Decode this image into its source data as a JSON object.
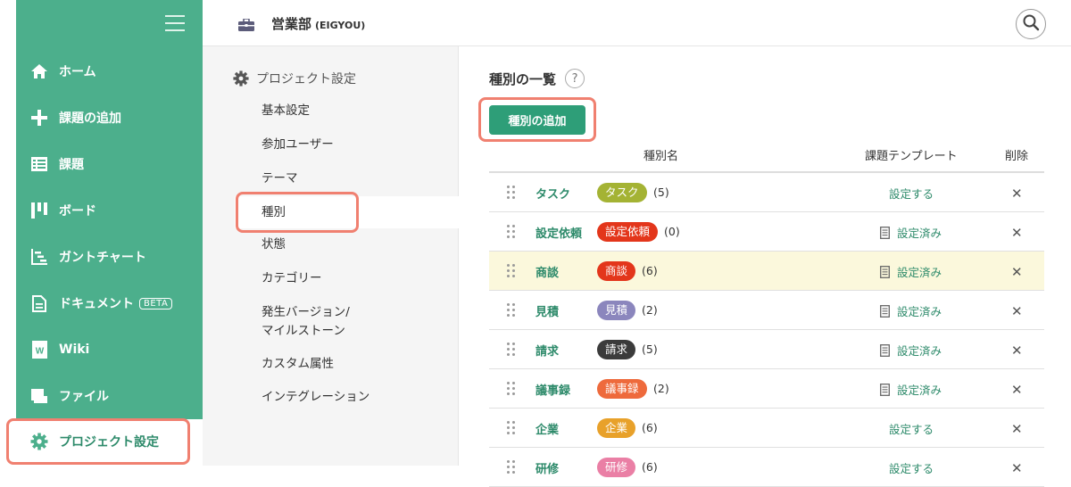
{
  "header": {
    "project_name": "営業部",
    "project_code": "(EIGYOU)"
  },
  "sidebar": {
    "items": [
      {
        "label": "ホーム",
        "icon": "home-icon"
      },
      {
        "label": "課題の追加",
        "icon": "plus-icon"
      },
      {
        "label": "課題",
        "icon": "list-icon"
      },
      {
        "label": "ボード",
        "icon": "board-icon"
      },
      {
        "label": "ガントチャート",
        "icon": "gantt-icon"
      },
      {
        "label": "ドキュメント",
        "icon": "document-icon",
        "badge": "BETA"
      },
      {
        "label": "Wiki",
        "icon": "wiki-icon"
      },
      {
        "label": "ファイル",
        "icon": "folder-icon"
      }
    ],
    "active_item": {
      "label": "プロジェクト設定",
      "icon": "gear-icon"
    }
  },
  "subnav": {
    "heading": "プロジェクト設定",
    "items": [
      "基本設定",
      "参加ユーザー",
      "テーマ",
      "種別",
      "状態",
      "カテゴリー",
      "発生バージョン/",
      "マイルストーン",
      "カスタム属性",
      "インテグレーション"
    ],
    "active": "種別"
  },
  "main": {
    "title": "種別の一覧",
    "help": "?",
    "add_button": "種別の追加",
    "columns": {
      "name": "種別名",
      "template": "課題テンプレート",
      "delete": "削除"
    },
    "rows": [
      {
        "name": "タスク",
        "chip": "タスク",
        "chip_color": "#a4b334",
        "count": "(5)",
        "template": "設定する",
        "template_set": false
      },
      {
        "name": "設定依頼",
        "chip": "設定依頼",
        "chip_color": "#e3361b",
        "count": "(0)",
        "template": "設定済み",
        "template_set": true
      },
      {
        "name": "商談",
        "chip": "商談",
        "chip_color": "#e3361b",
        "count": "(6)",
        "template": "設定済み",
        "template_set": true,
        "highlight": true
      },
      {
        "name": "見積",
        "chip": "見積",
        "chip_color": "#8b86bd",
        "count": "(2)",
        "template": "設定済み",
        "template_set": true
      },
      {
        "name": "請求",
        "chip": "請求",
        "chip_color": "#3b3b3b",
        "count": "(5)",
        "template": "設定済み",
        "template_set": true
      },
      {
        "name": "議事録",
        "chip": "議事録",
        "chip_color": "#ee6a3c",
        "count": "(2)",
        "template": "設定済み",
        "template_set": true
      },
      {
        "name": "企業",
        "chip": "企業",
        "chip_color": "#e8a12a",
        "count": "(6)",
        "template": "設定する",
        "template_set": false
      },
      {
        "name": "研修",
        "chip": "研修",
        "chip_color": "#ea7fa5",
        "count": "(6)",
        "template": "設定する",
        "template_set": false
      }
    ],
    "delete_symbol": "✕"
  }
}
